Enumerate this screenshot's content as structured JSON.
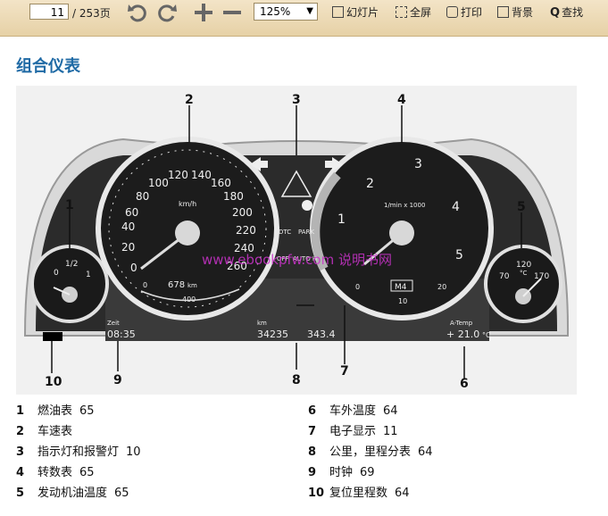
{
  "toolbar": {
    "page_current": "11",
    "page_total": "/ 253页",
    "zoom": "125%",
    "slideshow": "幻灯片",
    "fullscreen": "全屏",
    "print": "打印",
    "background": "背景",
    "find": "查找",
    "icons": [
      "undo-icon",
      "redo-icon",
      "zoom-in-icon",
      "zoom-out-icon"
    ]
  },
  "heading": "组合仪表",
  "figure": {
    "callouts": [
      "1",
      "2",
      "3",
      "4",
      "5",
      "6",
      "7",
      "8",
      "9",
      "10"
    ],
    "speedo": {
      "ticks": [
        "0",
        "20",
        "40",
        "60",
        "80",
        "100",
        "120",
        "140",
        "160",
        "180",
        "200",
        "220",
        "240",
        "260"
      ],
      "unit": "km/h",
      "range": "678",
      "range_unit": "km",
      "sub_scale": [
        "0",
        "400"
      ]
    },
    "tacho": {
      "ticks": [
        "1",
        "2",
        "3",
        "4",
        "5"
      ],
      "unit": "1/min x 1000",
      "gear": "M4",
      "sub_scale": [
        "0",
        "10",
        "20"
      ]
    },
    "fuel": {
      "labels": [
        "0",
        "1/2",
        "1"
      ]
    },
    "oil": {
      "labels": [
        "70",
        "120",
        "170"
      ],
      "unit": "°C"
    },
    "indicators": {
      "dtc": "DTC",
      "park": "PARK",
      "off": "OFF",
      "auto": "AUTO H"
    },
    "display": {
      "time_label": "Zeit",
      "time": "08:35",
      "odo_label": "km",
      "odo": "34235",
      "trip": "343.4",
      "temp_label": "A-Temp",
      "temp": "+ 21.0",
      "temp_unit": "°C"
    },
    "watermark": "www.ebookpfw.com 说明书网"
  },
  "legend": [
    {
      "num": "1",
      "text": "燃油表",
      "page": "65"
    },
    {
      "num": "2",
      "text": "车速表",
      "page": ""
    },
    {
      "num": "3",
      "text": "指示灯和报警灯",
      "page": "10"
    },
    {
      "num": "4",
      "text": "转数表",
      "page": "65"
    },
    {
      "num": "5",
      "text": "发动机油温度",
      "page": "65"
    },
    {
      "num": "6",
      "text": "车外温度",
      "page": "64"
    },
    {
      "num": "7",
      "text": "电子显示",
      "page": "11"
    },
    {
      "num": "8",
      "text": "公里，里程分表",
      "page": "64"
    },
    {
      "num": "9",
      "text": "时钟",
      "page": "69"
    },
    {
      "num": "10",
      "text": "复位里程数",
      "page": "64"
    }
  ]
}
